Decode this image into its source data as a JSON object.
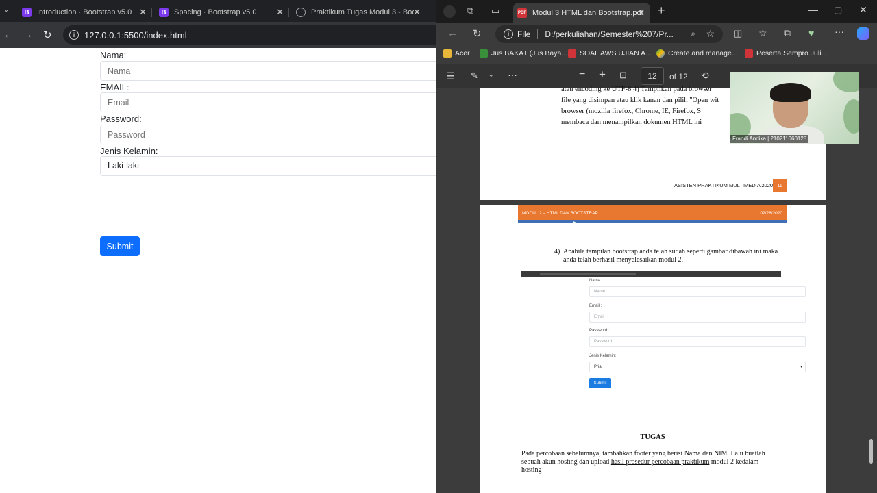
{
  "left_browser": {
    "tabs": [
      {
        "title": "Introduction · Bootstrap v5.0",
        "icon": "bootstrap-icon"
      },
      {
        "title": "Spacing · Bootstrap v5.0",
        "icon": "bootstrap-icon"
      },
      {
        "title": "Praktikum Tugas Modul 3 - Boo",
        "icon": "globe-icon"
      }
    ],
    "url": "127.0.0.1:5500/index.html",
    "form": {
      "nama_label": "Nama:",
      "nama_placeholder": "Nama",
      "email_label": "EMAIL:",
      "email_placeholder": "Email",
      "password_label": "Password:",
      "password_placeholder": "Password",
      "gender_label": "Jenis Kelamin:",
      "gender_value": "Laki-laki",
      "submit_label": "Submit"
    }
  },
  "right_browser": {
    "tab_title": "Modul 3 HTML dan Bootstrap.pdf",
    "address_prefix": "File",
    "address": "D:/perkuliahan/Semester%207/Pr...",
    "bookmarks": [
      "Acer",
      "Jus BAKAT (Jus Baya...",
      "SOAL AWS UJIAN A...",
      "Create and manage...",
      "Peserta Sempro Juli..."
    ],
    "pdf_toolbar": {
      "page_current": "12",
      "page_total": "of 12"
    },
    "page_a": {
      "lines": [
        "atau encoding ke UTF-8 4) Tampilkan pada browser",
        "file yang disimpan atau klik kanan dan pilih \"Open wit",
        "browser (mozilla firefox, Chrome, IE, Firefox, S",
        "membaca dan menampilkan dokumen HTML ini"
      ],
      "footer": "ASISTEN PRAKTIKUM MULTIMEDIA 2020",
      "page_number": "11"
    },
    "page_b": {
      "header_left": "MODUL 2 – HTML DAN BOOTSTRAP",
      "header_right": "02/28/2020",
      "item_number": "4)",
      "item_text_1": "Apabila tampilan bootstrap anda telah sudah seperti gambar dibawah ini maka",
      "item_text_2": "anda telah berhasil menyelesaikan modul 2.",
      "mini_form": {
        "nama_label": "Nama :",
        "nama_placeholder": "Name",
        "email_label": "Email :",
        "email_placeholder": "Email",
        "password_label": "Password :",
        "password_placeholder": "Password",
        "gender_label": "Jenis Kelamin:",
        "gender_value": "Pria",
        "submit_label": "Submit"
      },
      "section_title": "TUGAS",
      "body_1": "Pada percobaan sebelumnya, tambahkan footer yang berisi Nama dan NIM. Lalu buatlah",
      "body_2_pre": "sebuah akun hosting dan upload ",
      "body_2_link": "hasil prosedur percobaan praktikum",
      "body_2_post": " modul 2 kedalam",
      "body_3": "hosting"
    },
    "webcam_label": "Frandi Andika | 210211060128"
  },
  "colors": {
    "bootstrap_primary": "#0d6efd",
    "pdf_header_orange": "#e8782f",
    "pdf_header_blue": "#3f6fb5"
  }
}
